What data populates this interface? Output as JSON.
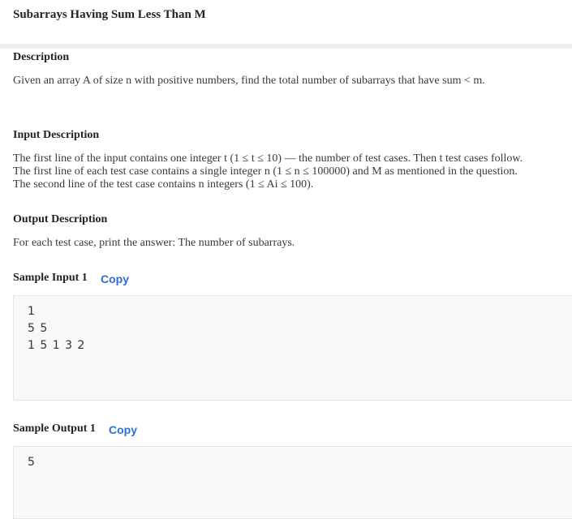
{
  "problem": {
    "title": "Subarrays Having Sum Less Than M"
  },
  "description": {
    "heading": "Description",
    "text": "Given an array A of size n with positive numbers, find the total number of subarrays that have sum < m."
  },
  "input_description": {
    "heading": "Input Description",
    "lines": [
      "The first line of the input contains one integer t (1 ≤ t ≤ 10) — the number of test cases. Then t test cases follow.",
      "The first line of each test case contains a single integer n (1 ≤ n ≤ 100000) and M as mentioned in the question.",
      "The second line of the test case contains n integers (1 ≤ Ai ≤ 100)."
    ]
  },
  "output_description": {
    "heading": "Output Description",
    "text": "For each test case, print the answer: The number of subarrays."
  },
  "sample_input": {
    "heading": "Sample Input 1",
    "copy_label": "Copy",
    "lines": [
      "1",
      "5 5",
      "1 5 1 3 2"
    ]
  },
  "sample_output": {
    "heading": "Sample Output 1",
    "copy_label": "Copy",
    "lines": [
      "5"
    ]
  },
  "colors": {
    "link": "#2f6fcf",
    "code_background": "#f7f8fa",
    "divider": "#f0f0f0"
  }
}
